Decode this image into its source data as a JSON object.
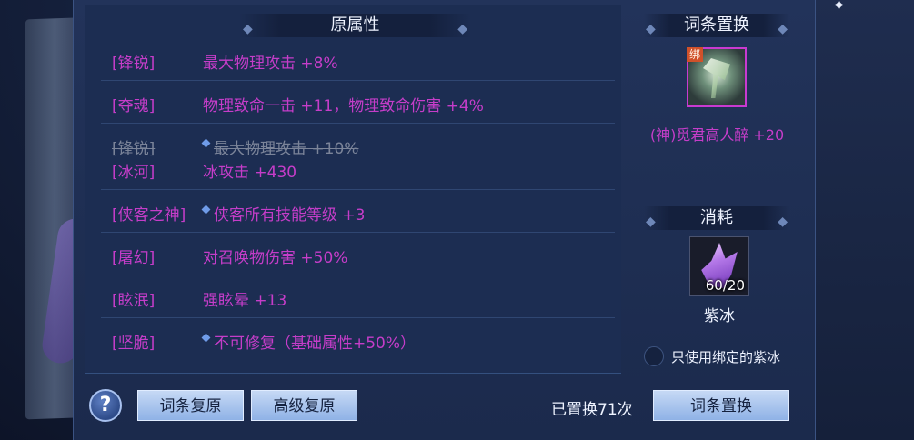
{
  "attributes": {
    "header": "原属性",
    "rows": [
      {
        "label": "[锋锐]",
        "value": "最大物理攻击 +8%"
      },
      {
        "label": "[夺魂]",
        "value": "物理致命一击 +11，物理致命伤害 +4%"
      },
      {
        "label": "[锋锐]",
        "value": "最大物理攻击 +10%",
        "label2": "[冰河]",
        "value2": "冰攻击 +430"
      },
      {
        "label": "[侠客之神]",
        "value": "侠客所有技能等级 +3"
      },
      {
        "label": "[屠幻]",
        "value": "对召唤物伤害 +50%"
      },
      {
        "label": "[眩泯]",
        "value": "强眩晕 +13"
      },
      {
        "label": "[坚脆]",
        "value": "不可修复（基础属性+50%）"
      }
    ]
  },
  "replace_panel": {
    "header": "词条置换",
    "item_badge": "绑",
    "item_name": "(神)觅君高人醉 +20",
    "consume_header": "消耗",
    "consume_count": "60/20",
    "consume_name": "紫冰",
    "bound_only_label": "只使用绑定的紫冰"
  },
  "bottom_bar": {
    "help_label": "?",
    "restore_label": "词条复原",
    "advanced_restore_label": "高级复原",
    "replace_count_text": "已置换71次",
    "replace_label": "词条置换"
  },
  "colors": {
    "attribute_text": "#c53dc9",
    "panel_bg": "#1c2d52",
    "button_bg": "#a9c4ee"
  }
}
